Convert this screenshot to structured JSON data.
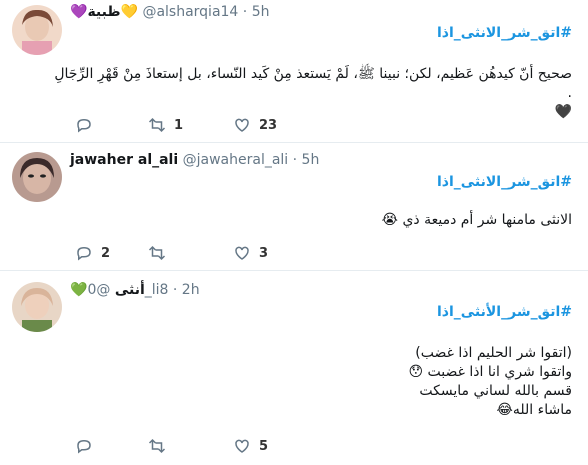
{
  "tweets": [
    {
      "name": "💜ظبية💛",
      "handle": "@alsharqia14",
      "time": "· 5h",
      "hashtag": "#اتق_شر_الانثى_اذا",
      "lines": [
        "صحيح أنّ كيدهُن عَظيم، لكن؛ نبينا ﷺ، لَمْ يَستعذ مِنْ كَيد النّساء، بل إستعاذَ مِنْ قَهْرِ الرِّجَالِ .",
        "🖤"
      ],
      "replies": "",
      "retweets": "1",
      "likes": "23",
      "avatar_colors": [
        "#e9c9b4",
        "#7a4a38"
      ]
    },
    {
      "name": "jawaher al_ali",
      "handle": "@jawaheral_ali",
      "time": "· 5h",
      "hashtag": "#اتق_شر_الانثى_اذا",
      "lines": [
        "الانثى مامنها شر أم دميعة ذي 😭"
      ],
      "replies": "2",
      "retweets": "",
      "likes": "3",
      "avatar_colors": [
        "#c8a89a",
        "#3a2a2a"
      ]
    },
    {
      "name": "💚أنثى",
      "handle": "@0_li8",
      "time": "· 2h",
      "hashtag": "#اتق_شر_الأنثى_اذا",
      "lines": [
        "(اتقوا شر الحليم اذا غضب)",
        "واتقوا شري انا اذا غضبت 😯",
        "قسم بالله لساني مايسكت",
        "ماشاء الله😂"
      ],
      "replies": "",
      "retweets": "",
      "likes": "5",
      "avatar_colors": [
        "#d9b49a",
        "#6a8a4a"
      ]
    }
  ]
}
